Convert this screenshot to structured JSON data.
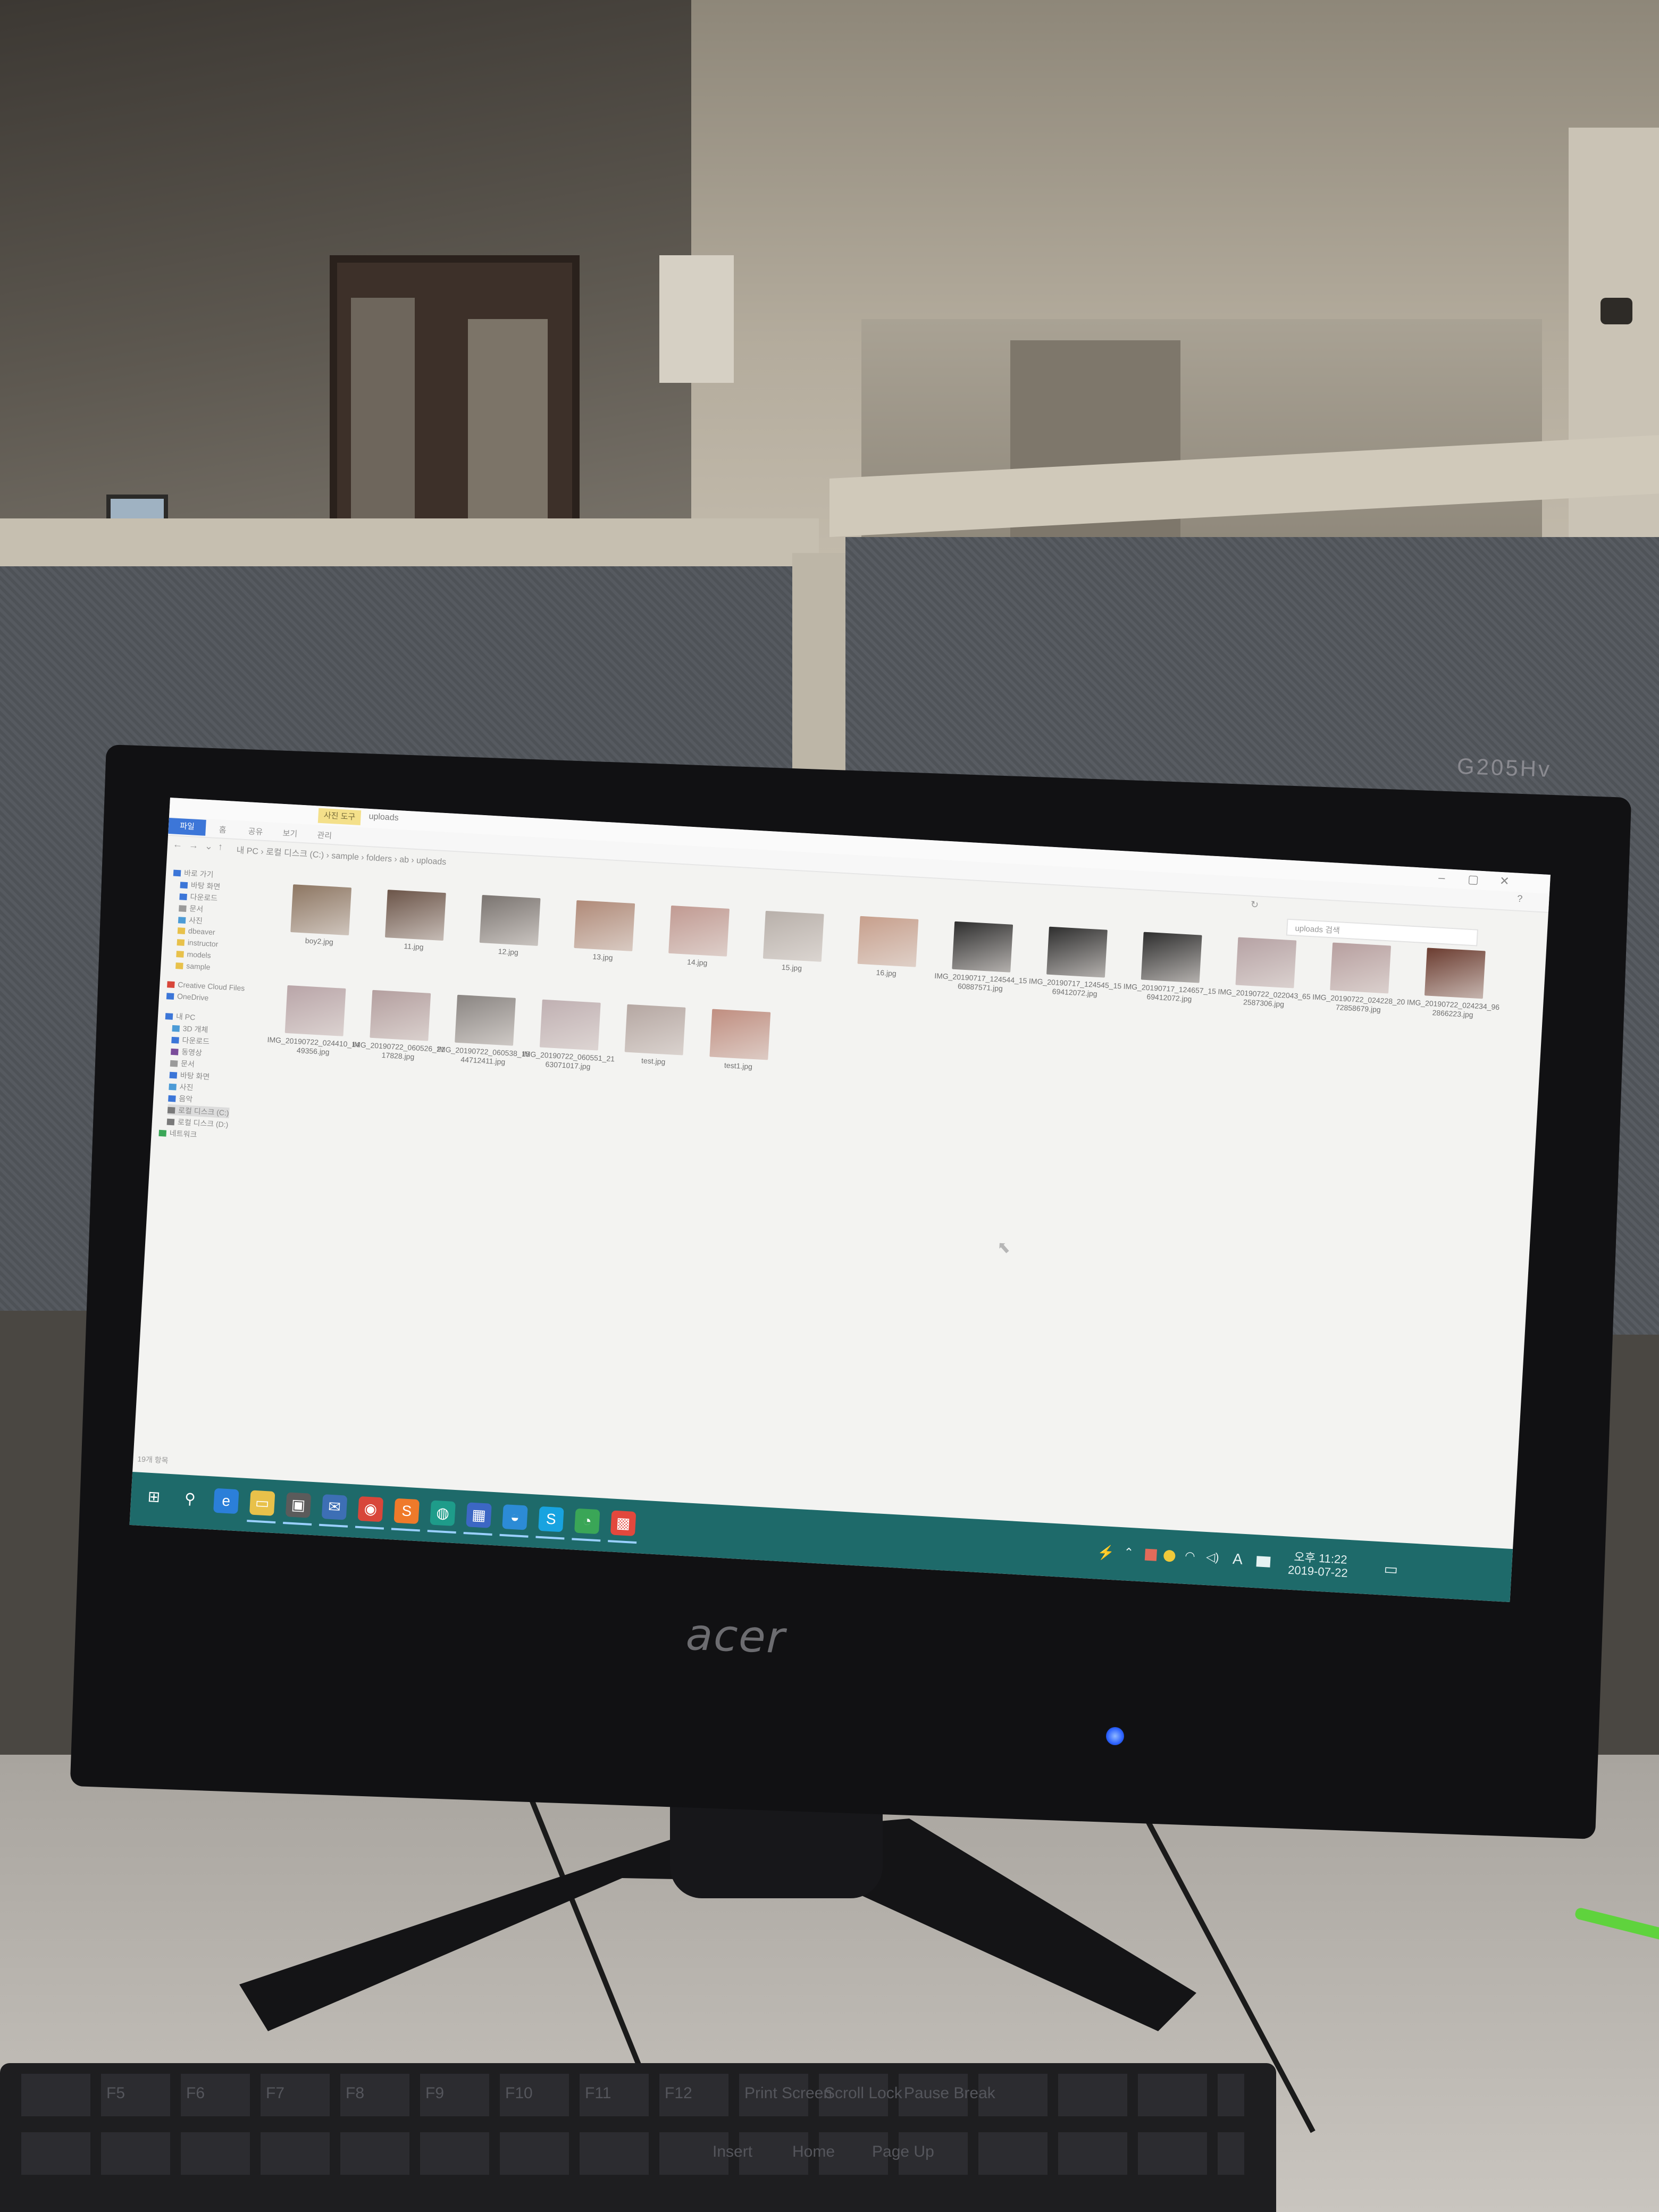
{
  "monitor": {
    "brand": "acer",
    "model": "G205Hv",
    "led_color": "#2c62ff"
  },
  "explorer": {
    "window_title": "uploads",
    "title_tab": "사진 도구",
    "ribbon": {
      "file": "파일",
      "tabs": [
        "홈",
        "공유",
        "보기",
        "관리"
      ]
    },
    "address_path": [
      "내 PC",
      "로컬 디스크 (C:)",
      "sample",
      "folders",
      "ab",
      "uploads"
    ],
    "search_placeholder": "uploads 검색",
    "nav_items": [
      {
        "label": "바로 가기",
        "icon": "star-icon"
      },
      {
        "label": "바탕 화면",
        "icon": "desktop-icon"
      },
      {
        "label": "다운로드",
        "icon": "download-icon"
      },
      {
        "label": "문서",
        "icon": "document-icon"
      },
      {
        "label": "사진",
        "icon": "picture-icon"
      },
      {
        "label": "dbeaver",
        "icon": "folder-icon"
      },
      {
        "label": "instructor",
        "icon": "folder-icon"
      },
      {
        "label": "models",
        "icon": "folder-icon"
      },
      {
        "label": "sample",
        "icon": "folder-icon"
      },
      {
        "label": "Creative Cloud Files",
        "icon": "cloud-icon"
      },
      {
        "label": "OneDrive",
        "icon": "onedrive-icon"
      },
      {
        "label": "내 PC",
        "icon": "pc-icon"
      },
      {
        "label": "3D 개체",
        "icon": "cube-icon"
      },
      {
        "label": "다운로드",
        "icon": "download-icon"
      },
      {
        "label": "동영상",
        "icon": "video-icon"
      },
      {
        "label": "문서",
        "icon": "document-icon"
      },
      {
        "label": "바탕 화면",
        "icon": "desktop-icon"
      },
      {
        "label": "사진",
        "icon": "picture-icon"
      },
      {
        "label": "음악",
        "icon": "music-icon"
      },
      {
        "label": "로컬 디스크 (C:)",
        "icon": "disk-icon"
      },
      {
        "label": "로컬 디스크 (D:)",
        "icon": "disk-icon"
      },
      {
        "label": "네트워크",
        "icon": "network-icon"
      }
    ],
    "files_row1": [
      {
        "name": "boy2.jpg",
        "color": "#8d7662"
      },
      {
        "name": "11.jpg",
        "color": "#6b5448"
      },
      {
        "name": "12.jpg",
        "color": "#7a7470"
      },
      {
        "name": "13.jpg",
        "color": "#b08a78"
      },
      {
        "name": "14.jpg",
        "color": "#c19a92"
      },
      {
        "name": "15.jpg",
        "color": "#b8b0aa"
      },
      {
        "name": "16.jpg",
        "color": "#c79f8c"
      },
      {
        "name": "IMG_20190717_124544_1560887571.jpg",
        "color": "#2e2e2e"
      },
      {
        "name": "IMG_20190717_124545_1569412072.jpg",
        "color": "#2e2e2e"
      },
      {
        "name": "IMG_20190717_124657_1569412072.jpg",
        "color": "#2e2e2e"
      },
      {
        "name": "IMG_20190722_022043_652587306.jpg",
        "color": "#b6a2a4"
      },
      {
        "name": "IMG_20190722_024228_2072858679.jpg",
        "color": "#b79f9f"
      },
      {
        "name": "IMG_20190722_024234_962866223.jpg",
        "color": "#6b3c30"
      }
    ],
    "files_row2": [
      {
        "name": "IMG_20190722_024410_1449356.jpg",
        "color": "#b9a5a8"
      },
      {
        "name": "IMG_20190722_060526_2117828.jpg",
        "color": "#b49f9f"
      },
      {
        "name": "IMG_20190722_060538_1544712411.jpg",
        "color": "#8a8582"
      },
      {
        "name": "IMG_20190722_060551_2163071017.jpg",
        "color": "#c0b0b2"
      },
      {
        "name": "test.jpg",
        "color": "#b5a7a2"
      },
      {
        "name": "test1.jpg",
        "color": "#c08e80"
      }
    ],
    "status": "19개 항목"
  },
  "taskbar": {
    "color": "#1e6a6a",
    "apps": [
      {
        "name": "start",
        "glyph": "⊞",
        "bg": "transparent"
      },
      {
        "name": "search",
        "glyph": "⚲",
        "bg": "transparent"
      },
      {
        "name": "edge",
        "glyph": "e",
        "bg": "#2b7fd9"
      },
      {
        "name": "file-explorer",
        "glyph": "▭",
        "bg": "#e8c14a"
      },
      {
        "name": "store",
        "glyph": "▣",
        "bg": "#5b5b5b"
      },
      {
        "name": "mail",
        "glyph": "✉",
        "bg": "#3d6fb5"
      },
      {
        "name": "chrome",
        "glyph": "◉",
        "bg": "#d8463a"
      },
      {
        "name": "sublime",
        "glyph": "S",
        "bg": "#ef7a2a"
      },
      {
        "name": "app-green",
        "glyph": "◍",
        "bg": "#1e9c8a"
      },
      {
        "name": "app-blue",
        "glyph": "▦",
        "bg": "#3c67c4"
      },
      {
        "name": "app-globe",
        "glyph": "◒",
        "bg": "#2c8bd6"
      },
      {
        "name": "skype",
        "glyph": "S",
        "bg": "#18a3e0"
      },
      {
        "name": "kakao",
        "glyph": "◔",
        "bg": "#3aa657"
      },
      {
        "name": "app-red",
        "glyph": "▩",
        "bg": "#e2483d"
      }
    ],
    "tray": {
      "ime": "A",
      "time": "오후 11:22",
      "date": "2019-07-22"
    }
  },
  "keyboard": {
    "legends": [
      "F5",
      "F6",
      "F7",
      "F8",
      "F9",
      "F10",
      "F11",
      "F12",
      "Print Screen",
      "Scroll Lock",
      "Pause Break"
    ],
    "legends_row2": [
      "Insert",
      "Home",
      "Page Up"
    ]
  }
}
